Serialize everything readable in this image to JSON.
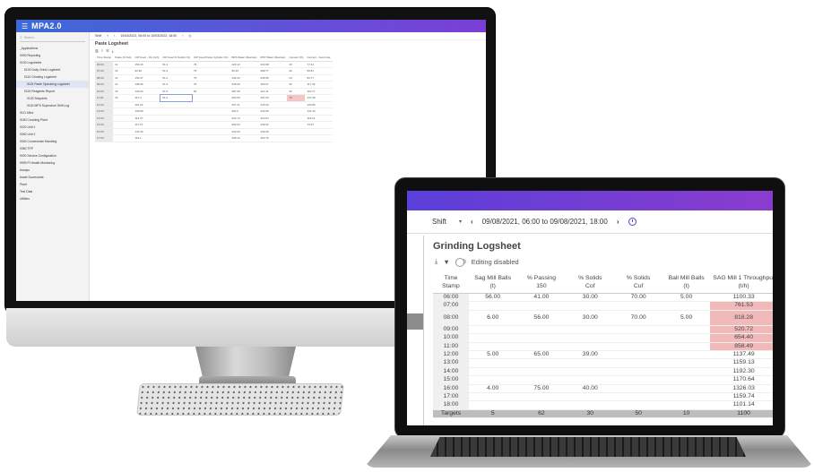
{
  "imac": {
    "app_title": "MPA2.0",
    "search_placeholder": "Search...",
    "sidebar": [
      {
        "label": "_Applications",
        "level": 0,
        "selected": false
      },
      {
        "label": "0000 Reporting",
        "level": 0,
        "selected": false
      },
      {
        "label": "0100 Logsheets",
        "level": 0,
        "selected": false
      },
      {
        "label": "0100 Daily Grind Logsheet",
        "level": 1,
        "selected": false
      },
      {
        "label": "0110 Grinding Logsheet",
        "level": 1,
        "selected": false
      },
      {
        "label": "0115 Paste Operating Logsheet",
        "level": 2,
        "selected": true
      },
      {
        "label": "0115 Reagents Report",
        "level": 1,
        "selected": false
      },
      {
        "label": "0130 Setpoints",
        "level": 2,
        "selected": false
      },
      {
        "label": "0140 MPS Supervisor Shift Log",
        "level": 2,
        "selected": false
      },
      {
        "label": "0111 Mine",
        "level": 0,
        "selected": false
      },
      {
        "label": "0180 Crushing Plant",
        "level": 0,
        "selected": false
      },
      {
        "label": "0220 Unit 1",
        "level": 0,
        "selected": false
      },
      {
        "label": "0260 Unit 2",
        "level": 0,
        "selected": false
      },
      {
        "label": "0340 Concentrate Handling",
        "level": 0,
        "selected": false
      },
      {
        "label": "0360 TPP",
        "level": 0,
        "selected": false
      },
      {
        "label": "9000 Service Configuration",
        "level": 0,
        "selected": false
      },
      {
        "label": "9999 PI Health Monitoring",
        "level": 0,
        "selected": false
      },
      {
        "label": "Assays",
        "level": 0,
        "selected": false
      },
      {
        "label": "Asset Scorecards",
        "level": 0,
        "selected": false
      },
      {
        "label": "Plant",
        "level": 0,
        "selected": false
      },
      {
        "label": "Test Data",
        "level": 0,
        "selected": false
      },
      {
        "label": "Utilities",
        "level": 0,
        "selected": false
      }
    ],
    "filter": {
      "shift": "Shift",
      "range": "10/03/2023, 06:00 to 10/03/2023, 18:00"
    },
    "logsheet_title": "Paste Logsheet",
    "columns": [
      "Time Stamp",
      "Paste (% Sol)",
      "CIP Feed - Dry (tph)",
      "CIP Feed % Solids (%)",
      "CIP Feed Paste Cylinder (%)",
      "BPS Water (flowrate)",
      "RTP Water (flowrate)",
      "Cement (%)",
      "Cement - Feed rate"
    ],
    "rows": [
      [
        "06:00",
        "14",
        "159.16",
        "51.3",
        "75",
        "123.13",
        "333.98",
        "20",
        "77.41"
      ],
      [
        "07:00",
        "15",
        "93.56",
        "51.2",
        "75",
        "96.33",
        "288.77",
        "20",
        "59.81"
      ],
      [
        "08:00",
        "14",
        "153.47",
        "51.2",
        "75",
        "132.33",
        "335.08",
        "24",
        "84.77"
      ],
      [
        "09:00",
        "14",
        "108.30",
        "51.3",
        "75",
        "245.09",
        "360.37",
        "20",
        "117.49"
      ],
      [
        "10:00",
        "15",
        "125.23",
        "51.5",
        "60",
        "287.08",
        "423.11",
        "20",
        "110.77"
      ],
      [
        "11:00",
        "15",
        "114.4",
        "51.3",
        "",
        "203.65",
        "401.53",
        "70",
        "137.09"
      ],
      [
        "12:00",
        "",
        "115.22",
        "",
        "",
        "247.21",
        "415.29",
        "",
        "104.05"
      ],
      [
        "13:00",
        "",
        "109.59",
        "",
        "",
        "301.6",
        "434.50",
        "",
        "131.43"
      ],
      [
        "14:00",
        "",
        "114.47",
        "",
        "",
        "312.73",
        "424.64",
        "",
        "118.21"
      ],
      [
        "15:00",
        "",
        "117.37",
        "",
        "",
        "309.64",
        "449.42",
        "",
        "73.07"
      ],
      [
        "16:00",
        "",
        "124.33",
        "",
        "",
        "310.93",
        "436.49",
        "",
        ""
      ],
      [
        "17:00",
        "",
        "119.1",
        "",
        "",
        "336.13",
        "363.76",
        "",
        ""
      ]
    ]
  },
  "laptop": {
    "filter": {
      "shift": "Shift",
      "range": "09/08/2021, 06:00 to 09/08/2021, 18:00"
    },
    "logsheet_title": "Grinding Logsheet",
    "editing_label": "Editing disabled",
    "columns": [
      {
        "l1": "Time",
        "l2": "Stamp"
      },
      {
        "l1": "Sag Mill Balls",
        "l2": "(t)"
      },
      {
        "l1": "% Passing",
        "l2": "150"
      },
      {
        "l1": "% Solids",
        "l2": "Cof"
      },
      {
        "l1": "% Solids",
        "l2": "Cuf"
      },
      {
        "l1": "Ball Mill Balls",
        "l2": "(t)"
      },
      {
        "l1": "SAG Mill 1 Throughput",
        "l2": "(t/h)"
      }
    ],
    "rows": [
      [
        "06:00",
        "56.00",
        "41.00",
        "30.00",
        "70.00",
        "5.00",
        "1100.33"
      ],
      [
        "07:00",
        "",
        "",
        "",
        "",
        "",
        "761.53"
      ],
      [
        "08:00",
        "6.00",
        "56.00",
        "30.00",
        "70.00",
        "5.00",
        "818.28"
      ],
      [
        "09:00",
        "",
        "",
        "",
        "",
        "",
        "520.72"
      ],
      [
        "10:00",
        "",
        "",
        "",
        "",
        "",
        "654.40"
      ],
      [
        "11:00",
        "",
        "",
        "",
        "",
        "",
        "858.49"
      ],
      [
        "12:00",
        "5.00",
        "65.00",
        "39.00",
        "",
        "",
        "1137.49"
      ],
      [
        "13:00",
        "",
        "",
        "",
        "",
        "",
        "1159.13"
      ],
      [
        "14:00",
        "",
        "",
        "",
        "",
        "",
        "1192.30"
      ],
      [
        "15:00",
        "",
        "",
        "",
        "",
        "",
        "1170.64"
      ],
      [
        "16:00",
        "4.00",
        "75.00",
        "40.00",
        "",
        "",
        "1326.03"
      ],
      [
        "17:00",
        "",
        "",
        "",
        "",
        "",
        "1159.74"
      ],
      [
        "18:00",
        "",
        "",
        "",
        "",
        "",
        "1101.14"
      ]
    ],
    "targets": [
      "Targets",
      "5",
      "62",
      "30",
      "50",
      "10",
      "1100"
    ]
  },
  "colors": {
    "accent": "#5a3fd8",
    "brand_gradient_start": "#3c6ad8",
    "alert": "#f2b9b9"
  }
}
